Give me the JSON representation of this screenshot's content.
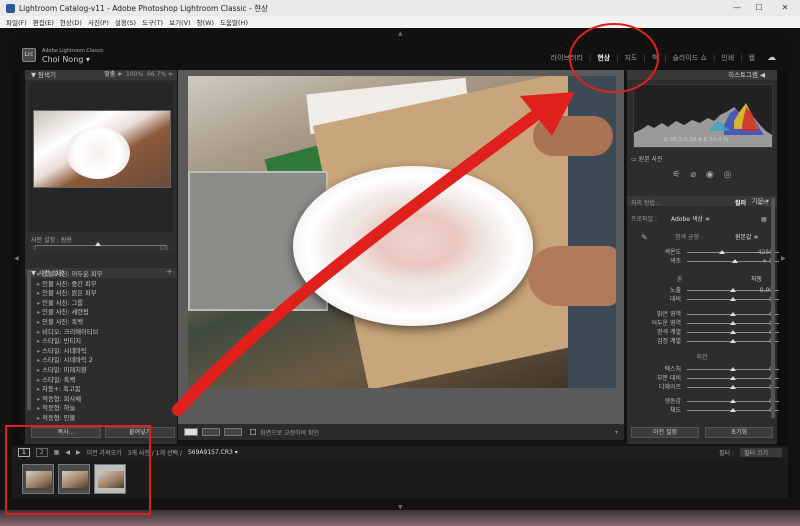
{
  "window": {
    "title": "Lightroom Catalog-v11 - Adobe Photoshop Lightroom Classic - 현상",
    "min": "—",
    "max": "☐",
    "close": "✕"
  },
  "menu": [
    "파일(F)",
    "편집(E)",
    "현상(D)",
    "사진(P)",
    "설정(S)",
    "도구(T)",
    "보기(V)",
    "창(W)",
    "도움말(H)"
  ],
  "header": {
    "logo": "Lrc",
    "brand": "Adobe Lightroom Classic",
    "owner": "Choi Nong"
  },
  "modules": [
    "라이브러리",
    "현상",
    "지도",
    "책",
    "슬라이드 쇼",
    "인쇄",
    "웹"
  ],
  "left": {
    "navigator": {
      "title": "탐색기",
      "fit": "맞춤 ≑",
      "zoom1": "100%",
      "zoom2": "66.7%"
    },
    "preset_amount": {
      "label": "사전 설정 : 원용",
      "left": "0",
      "right": "100"
    },
    "presets_title": "사전 설정",
    "presets": [
      "인물 사진: 어두운 피부",
      "인물 사진: 중간 피부",
      "인물 사진: 밝은 피부",
      "인물 사진: 그룹",
      "인물 사진: 세련됨",
      "인물 사진: 흑백",
      "비디오: 크리에이티브",
      "스타일: 빈티지",
      "스타일: 시네마틱",
      "스타일: 시네마틱 2",
      "스타일: 미래지향",
      "스타일: 흑백",
      "자동+: 흑고봄",
      "적응형: 피사체",
      "적응형: 하늘",
      "적응형: 인물"
    ],
    "copy_btn": "복사...",
    "paste_btn": "붙여넣기"
  },
  "toolbar": {
    "softproof": "화면으로 교정하여 확인"
  },
  "right": {
    "histogram_title": "히스토그램",
    "readout": {
      "r": "R",
      "rv": "58.3",
      "g": "G",
      "gv": "58.6",
      "b": "B",
      "bv": "55.4",
      "pct": "%"
    },
    "original_label": "원본 사진",
    "basic_title": "기본",
    "treatment": {
      "label": "처리 방법 :",
      "color": "컬러",
      "bw": "흑백"
    },
    "profile": {
      "label": "프로파일 :",
      "value": "Adobe 색상 ≑"
    },
    "wb": {
      "label": "흰색 균형 :",
      "value": "원본값 ≑"
    },
    "temp_tint": [
      {
        "label": "색온도",
        "val": "4250",
        "pos": 0.38
      },
      {
        "label": "색조",
        "val": "+ 5",
        "pos": 0.52
      }
    ],
    "tone_title": "톤",
    "tone_auto": "자동",
    "tone": [
      {
        "label": "노출",
        "val": "0.00",
        "pos": 0.5
      },
      {
        "label": "대비",
        "val": "0",
        "pos": 0.5
      }
    ],
    "tone2": [
      {
        "label": "밝은 영역",
        "val": "0",
        "pos": 0.5
      },
      {
        "label": "어두운 영역",
        "val": "0",
        "pos": 0.5
      },
      {
        "label": "흰색 계열",
        "val": "0",
        "pos": 0.5
      },
      {
        "label": "검정 계열",
        "val": "0",
        "pos": 0.5
      }
    ],
    "presence_title": "외관",
    "presence": [
      {
        "label": "텍스처",
        "val": "0",
        "pos": 0.5
      },
      {
        "label": "부분 대비",
        "val": "0",
        "pos": 0.5
      },
      {
        "label": "디헤이즈",
        "val": "0",
        "pos": 0.5
      }
    ],
    "presence2": [
      {
        "label": "생동감",
        "val": "0",
        "pos": 0.5
      },
      {
        "label": "채도",
        "val": "0",
        "pos": 0.5
      }
    ],
    "prev_btn": "이전 설정",
    "reset_btn": "초기화"
  },
  "filmstrip": {
    "page1": "1",
    "page2": "2",
    "source": "이전 가져오기",
    "count": "3개 사진 / 1개 선택 /",
    "file": "S69A9157.CR3 ▾",
    "filter_label": "필터 :",
    "filter_value": "필터 끄기"
  },
  "colors": {
    "annotation": "#e0201c",
    "accent": "#e6e6e6"
  }
}
